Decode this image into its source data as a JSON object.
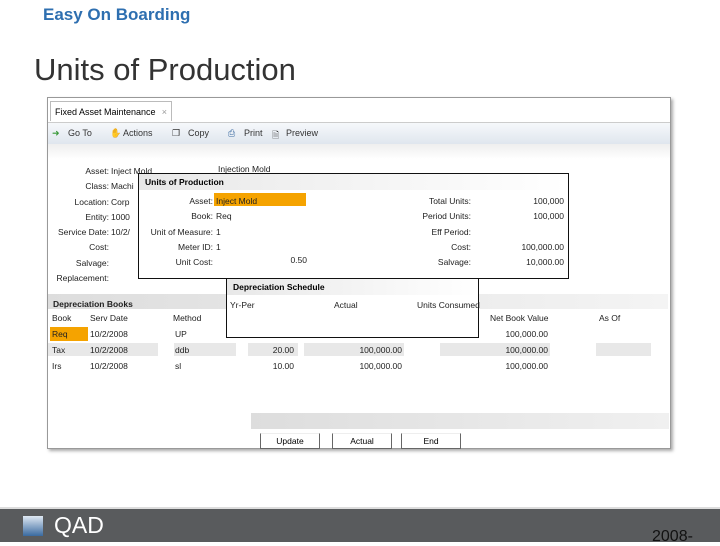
{
  "brand": "Easy On Boarding",
  "title": "Units of Production",
  "window": {
    "tab": "Fixed Asset Maintenance",
    "close": "×",
    "toolbar": [
      "Go To",
      "Actions",
      "Copy",
      "Print",
      "Preview"
    ]
  },
  "asset_form": {
    "labels": [
      "Asset:",
      "Class:",
      "Location:",
      "Entity:",
      "Service Date:",
      "Cost:",
      "Salvage:",
      "Replacement:"
    ],
    "values": [
      "Inject Mold",
      "Machi",
      "Corp",
      "1000",
      "10/2/",
      "",
      "",
      ""
    ],
    "description": "Injection Mold"
  },
  "uop": {
    "title": "Units of Production",
    "left_labels": [
      "Asset:",
      "Book:",
      "Unit of Measure:",
      "Meter ID:",
      "Unit Cost:"
    ],
    "left_values": [
      "Inject Mold",
      "Req",
      "1",
      "1",
      "0.50"
    ],
    "right_labels": [
      "Total Units:",
      "Period Units:",
      "Eff Period:",
      "Cost:",
      "Salvage:"
    ],
    "right_values": [
      "100,000",
      "100,000",
      "",
      "100,000.00",
      "10,000.00"
    ]
  },
  "schedule": {
    "title": "Depreciation Schedule",
    "cols": [
      "Yr-Per",
      "Actual",
      "Units Consumed"
    ]
  },
  "books": {
    "title": "Depreciation Books",
    "cols": [
      "Book",
      "Serv Date",
      "Method",
      "Net Book Value",
      "As Of"
    ],
    "rows": [
      [
        "Req",
        "10/2/2008",
        "UP",
        "",
        "",
        "100,000.00"
      ],
      [
        "Tax",
        "10/2/2008",
        "ddb",
        "20.00",
        "100,000.00",
        "100,000.00"
      ],
      [
        "Irs",
        "10/2/2008",
        "sl",
        "10.00",
        "100,000.00",
        "100,000.00"
      ]
    ]
  },
  "buttons": [
    "Update",
    "Actual",
    "End"
  ],
  "footer": {
    "logo": "QAD",
    "year": "2008-"
  },
  "colors": {
    "highlight": "#f5a300",
    "footer": "#595b5d",
    "brand": "#2e6fb0"
  }
}
